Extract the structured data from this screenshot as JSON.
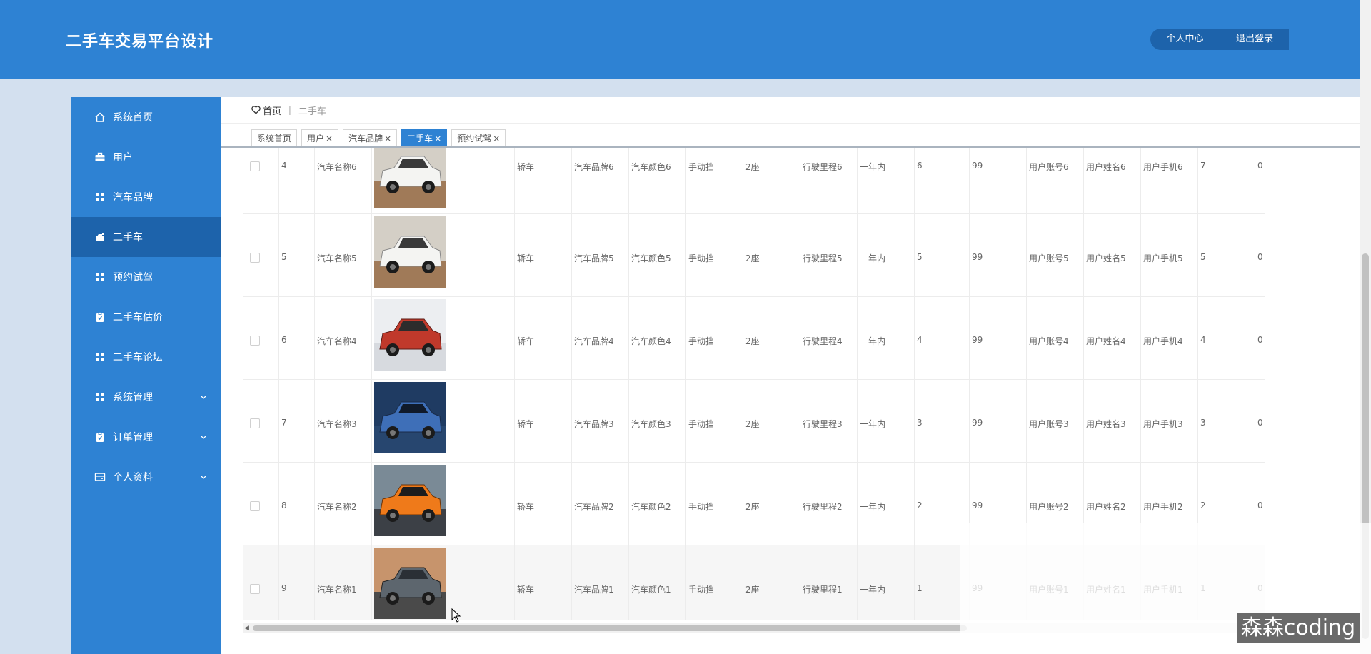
{
  "header": {
    "title": "二手车交易平台设计",
    "profile_btn": "个人中心",
    "logout_btn": "退出登录"
  },
  "sidebar": {
    "items": [
      {
        "label": "系统首页",
        "icon": "home-icon",
        "active": false,
        "expandable": false
      },
      {
        "label": "用户",
        "icon": "briefcase-icon",
        "active": false,
        "expandable": false
      },
      {
        "label": "汽车品牌",
        "icon": "grid-icon",
        "active": false,
        "expandable": false
      },
      {
        "label": "二手车",
        "icon": "car-icon",
        "active": true,
        "expandable": false
      },
      {
        "label": "预约试驾",
        "icon": "grid-icon",
        "active": false,
        "expandable": false
      },
      {
        "label": "二手车估价",
        "icon": "clipboard-icon",
        "active": false,
        "expandable": false
      },
      {
        "label": "二手车论坛",
        "icon": "grid-icon",
        "active": false,
        "expandable": false
      },
      {
        "label": "系统管理",
        "icon": "grid-icon",
        "active": false,
        "expandable": true
      },
      {
        "label": "订单管理",
        "icon": "clipboard-icon",
        "active": false,
        "expandable": true
      },
      {
        "label": "个人资料",
        "icon": "card-icon",
        "active": false,
        "expandable": true
      }
    ]
  },
  "breadcrumb": {
    "home": "首页",
    "separator": "ǀ",
    "current": "二手车"
  },
  "tabs": [
    {
      "label": "系统首页",
      "closable": false,
      "active": false
    },
    {
      "label": "用户",
      "closable": true,
      "active": false
    },
    {
      "label": "汽车品牌",
      "closable": true,
      "active": false
    },
    {
      "label": "二手车",
      "closable": true,
      "active": true
    },
    {
      "label": "预约试驾",
      "closable": true,
      "active": false
    }
  ],
  "colors": {
    "header": "#2e82d3",
    "sidebar": "#2e82d3",
    "active": "#1d63ab",
    "page_bg": "#d3e0ef"
  },
  "table": {
    "rows": [
      {
        "no": "4",
        "name": "汽车名称6",
        "img": "white-suv",
        "type": "轿车",
        "brand": "汽车品牌6",
        "color": "汽车颜色6",
        "gear": "手动挡",
        "seats": "2座",
        "mileage": "行驶里程6",
        "age": "一年内",
        "n1": "6",
        "n2": "99",
        "account": "用户账号6",
        "username": "用户姓名6",
        "phone": "用户手机6",
        "n3": "7",
        "n4": "0"
      },
      {
        "no": "5",
        "name": "汽车名称5",
        "img": "white-suv",
        "type": "轿车",
        "brand": "汽车品牌5",
        "color": "汽车颜色5",
        "gear": "手动挡",
        "seats": "2座",
        "mileage": "行驶里程5",
        "age": "一年内",
        "n1": "5",
        "n2": "99",
        "account": "用户账号5",
        "username": "用户姓名5",
        "phone": "用户手机5",
        "n3": "5",
        "n4": "0"
      },
      {
        "no": "6",
        "name": "汽车名称4",
        "img": "red-g",
        "type": "轿车",
        "brand": "汽车品牌4",
        "color": "汽车颜色4",
        "gear": "手动挡",
        "seats": "2座",
        "mileage": "行驶里程4",
        "age": "一年内",
        "n1": "4",
        "n2": "99",
        "account": "用户账号4",
        "username": "用户姓名4",
        "phone": "用户手机4",
        "n3": "4",
        "n4": "0"
      },
      {
        "no": "7",
        "name": "汽车名称3",
        "img": "blue-rr",
        "type": "轿车",
        "brand": "汽车品牌3",
        "color": "汽车颜色3",
        "gear": "手动挡",
        "seats": "2座",
        "mileage": "行驶里程3",
        "age": "一年内",
        "n1": "3",
        "n2": "99",
        "account": "用户账号3",
        "username": "用户姓名3",
        "phone": "用户手机3",
        "n3": "3",
        "n4": "0"
      },
      {
        "no": "8",
        "name": "汽车名称2",
        "img": "orange-sport",
        "type": "轿车",
        "brand": "汽车品牌2",
        "color": "汽车颜色2",
        "gear": "手动挡",
        "seats": "2座",
        "mileage": "行驶里程2",
        "age": "一年内",
        "n1": "2",
        "n2": "99",
        "account": "用户账号2",
        "username": "用户姓名2",
        "phone": "用户手机2",
        "n3": "2",
        "n4": "0"
      },
      {
        "no": "9",
        "name": "汽车名称1",
        "img": "grey-concept",
        "type": "轿车",
        "brand": "汽车品牌1",
        "color": "汽车颜色1",
        "gear": "手动挡",
        "seats": "2座",
        "mileage": "行驶里程1",
        "age": "一年内",
        "n1": "1",
        "n2": "99",
        "account": "用户账号1",
        "username": "用户姓名1",
        "phone": "用户手机1",
        "n3": "1",
        "n4": "0"
      }
    ]
  },
  "watermark": "森森coding"
}
